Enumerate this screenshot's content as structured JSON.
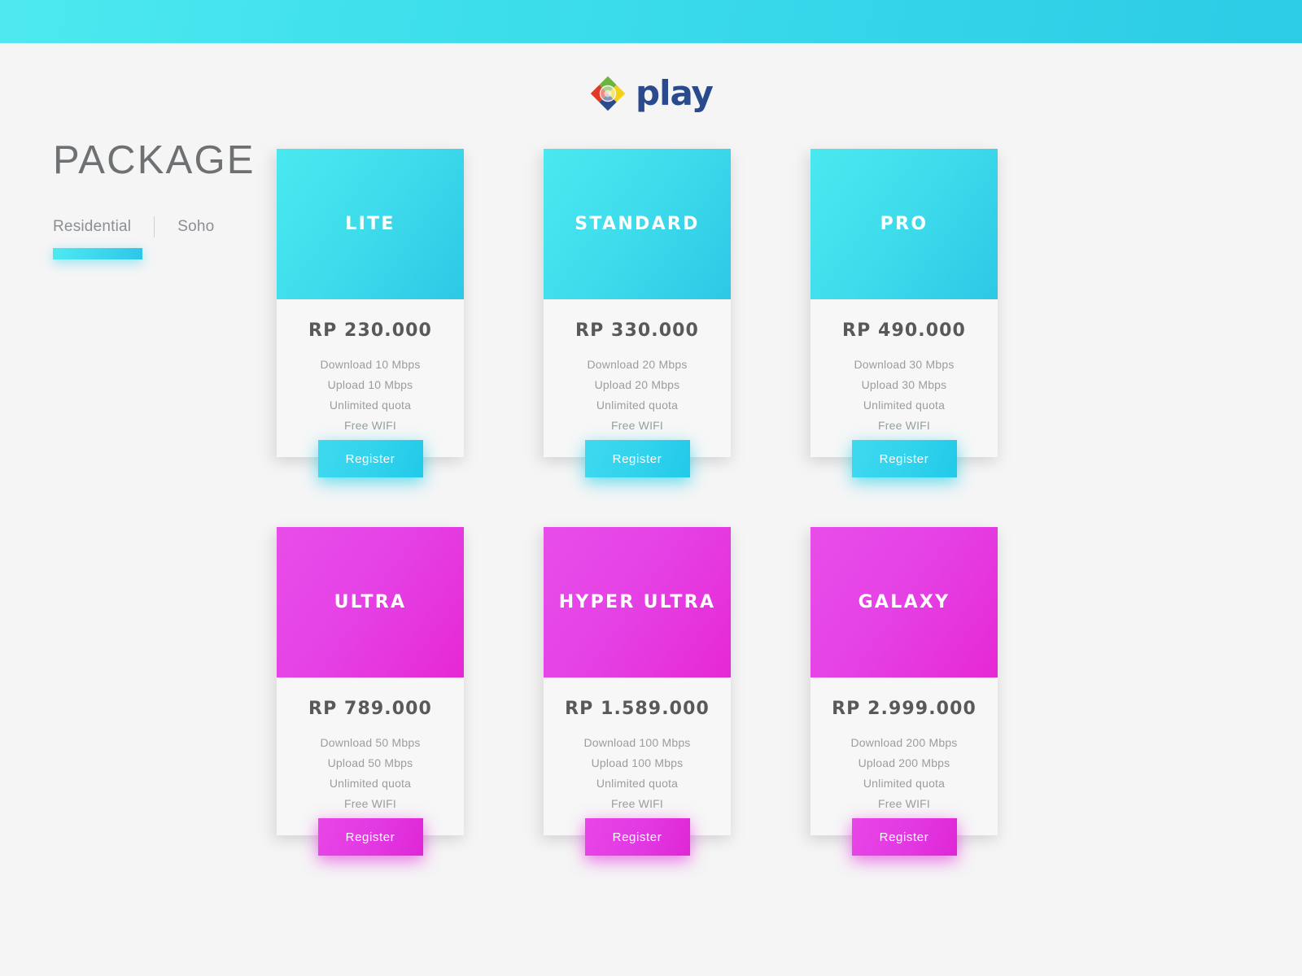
{
  "topbar": {
    "accent_color": "#3fe0ec"
  },
  "brand": {
    "logo_icon": "play-diamond-logo-icon",
    "name": "play",
    "wordmark_color": "#2a4a8d"
  },
  "heading": {
    "title": "PACKAGE"
  },
  "tabs": {
    "items": [
      {
        "label": "Residential",
        "active": true
      },
      {
        "label": "Soho",
        "active": false
      }
    ],
    "underline_color": "#2ec6e8"
  },
  "packages": [
    {
      "name": "LITE",
      "theme": "cyan",
      "price": "RP 230.000",
      "features": [
        "Download 10 Mbps",
        "Upload 10 Mbps",
        "Unlimited quota",
        "Free WIFI"
      ],
      "cta": "Register"
    },
    {
      "name": "STANDARD",
      "theme": "cyan",
      "price": "RP 330.000",
      "features": [
        "Download 20 Mbps",
        "Upload 20 Mbps",
        "Unlimited quota",
        "Free WIFI"
      ],
      "cta": "Register"
    },
    {
      "name": "PRO",
      "theme": "cyan",
      "price": "RP 490.000",
      "features": [
        "Download 30 Mbps",
        "Upload 30 Mbps",
        "Unlimited quota",
        "Free WIFI"
      ],
      "cta": "Register"
    },
    {
      "name": "ULTRA",
      "theme": "magenta",
      "price": "RP 789.000",
      "features": [
        "Download 50 Mbps",
        "Upload 50 Mbps",
        "Unlimited quota",
        "Free WIFI"
      ],
      "cta": "Register"
    },
    {
      "name": "HYPER ULTRA",
      "theme": "magenta",
      "price": "RP 1.589.000",
      "features": [
        "Download 100 Mbps",
        "Upload 100 Mbps",
        "Unlimited quota",
        "Free WIFI"
      ],
      "cta": "Register"
    },
    {
      "name": "GALAXY",
      "theme": "magenta",
      "price": "RP 2.999.000",
      "features": [
        "Download 200 Mbps",
        "Upload 200 Mbps",
        "Unlimited quota",
        "Free WIFI"
      ],
      "cta": "Register"
    }
  ],
  "colors": {
    "cyan": "#35d6e9",
    "magenta": "#e53ce4",
    "page_background": "#f5f5f5",
    "card_background": "#f7f7f7",
    "price_text": "#58595b",
    "feature_text": "#9a9da0",
    "heading_text": "#6e7173"
  }
}
